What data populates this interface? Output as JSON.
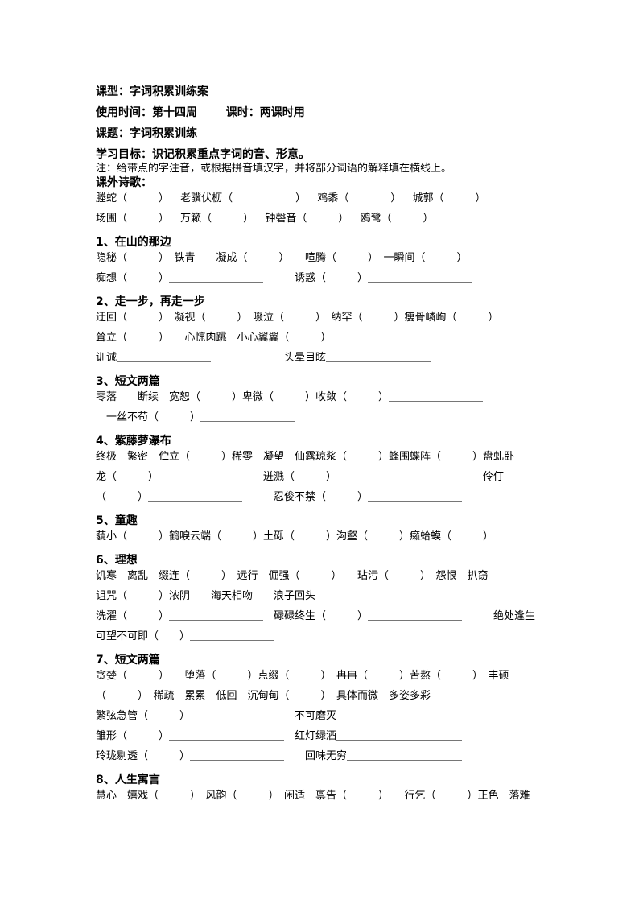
{
  "header": {
    "type_label": "课型：字词积累训练案",
    "time_label": "使用时间：第十四周",
    "period_label": "课时：两课时用",
    "topic_label": "课题：字词积累训练",
    "goal_label": "学习目标：识记积累重点字词的音、形意。",
    "note": "注：给带点的字注音，或根据拼音填汉字，并将部分词语的解释填在横线上。"
  },
  "poems": {
    "title": "课外诗歌：",
    "line1": [
      "塍蛇（　　　）",
      "老骥伏枥（　　　　　　）",
      "鸡黍（　　　　）",
      "城郭（　　　）"
    ],
    "line2": [
      "场圃（　　　）",
      "万籁（　　　）",
      "钟磬音（　　　）",
      "鸥鹭（　　　）"
    ]
  },
  "sections": [
    {
      "title": "1、在山的那边",
      "lines": [
        "隐秘（　　　）　铁青　　凝成（　　　）　　喧腾（　　　）　一瞬间（　　　）",
        "痴想（　　　）＿＿＿＿＿＿＿＿＿　　　诱惑（　　　）＿＿＿＿＿＿＿＿＿＿"
      ]
    },
    {
      "title": "2、走一步，再走一步",
      "lines": [
        "迂回（　　　）　凝视（　　　）　啜泣（　　　）　纳罕（　　　）瘦骨嶙峋（　　　）",
        "耸立（　　　）　　心惊肉跳　小心翼翼（　　　）",
        "训诫＿＿＿＿＿＿＿＿＿　　　　　　　头晕目眩＿＿＿＿＿＿＿＿＿＿"
      ]
    },
    {
      "title": "3、短文两篇",
      "lines": [
        "零落　　断续　宽恕（　　　）卑微（　　　）收敛（　　　）＿＿＿＿＿＿＿＿＿",
        "　一丝不苟（　　　）＿＿＿＿＿＿＿＿＿"
      ]
    },
    {
      "title": "4、紫藤萝瀑布",
      "lines": [
        "终极　繁密　伫立（　　　）稀零　凝望　仙露琼浆（　　　）蜂围蝶阵（　　　）盘虬卧",
        "龙（　　　）＿＿＿＿＿＿＿＿＿　迸溅（　　　）＿＿＿＿＿＿＿＿＿　　　　　伶仃",
        "（　　　）＿＿＿＿＿＿＿＿＿　　　忍俊不禁（　　　）＿＿＿＿＿＿＿＿＿"
      ]
    },
    {
      "title": "5、童趣",
      "lines": [
        "藐小（　　　）鹤唳云端（　　　）土砾（　　　）沟壑（　　　）癞蛤蟆（　　　）"
      ]
    },
    {
      "title": "6、理想",
      "lines": [
        "饥寒　离乱　缀连（　　　）　远行　倔强（　　　）　　玷污（　　　）　怨恨　扒窃",
        "诅咒（　　　）浓阴　　海天相吻　　浪子回头",
        "洗濯（　　　）＿＿＿＿＿＿＿＿＿　碌碌终生（　　　）＿＿＿＿＿＿＿＿＿　　　绝处逢生",
        "可望不可即（　　）＿＿＿＿＿＿＿＿"
      ]
    },
    {
      "title": "7、短文两篇",
      "lines": [
        "贪婪（　　　）　　堕落（　　　）点缀（　　　）　冉冉（　　　）苦熬（　　　）　丰硕",
        "（　　　）　稀疏　累累　低回　沉甸甸（　　　）　具体而微　多姿多彩",
        "繁弦急管（　　　）＿＿＿＿＿＿＿＿＿＿不可磨灭＿＿＿＿＿＿＿＿＿＿＿＿",
        "雏形（　　　）＿＿＿＿＿＿＿＿＿＿＿　红灯绿酒＿＿＿＿＿＿＿＿＿＿＿＿",
        "玲珑剔透（　　　）＿＿＿＿＿＿＿＿＿　　回味无穷＿＿＿＿＿＿＿＿＿＿＿"
      ]
    },
    {
      "title": "8、人生寓言",
      "lines": [
        "慧心　嬉戏（　　　）　风韵（　　　）　闲适　禀告（　　　）　　行乞（　　　）正色　落难"
      ]
    }
  ]
}
